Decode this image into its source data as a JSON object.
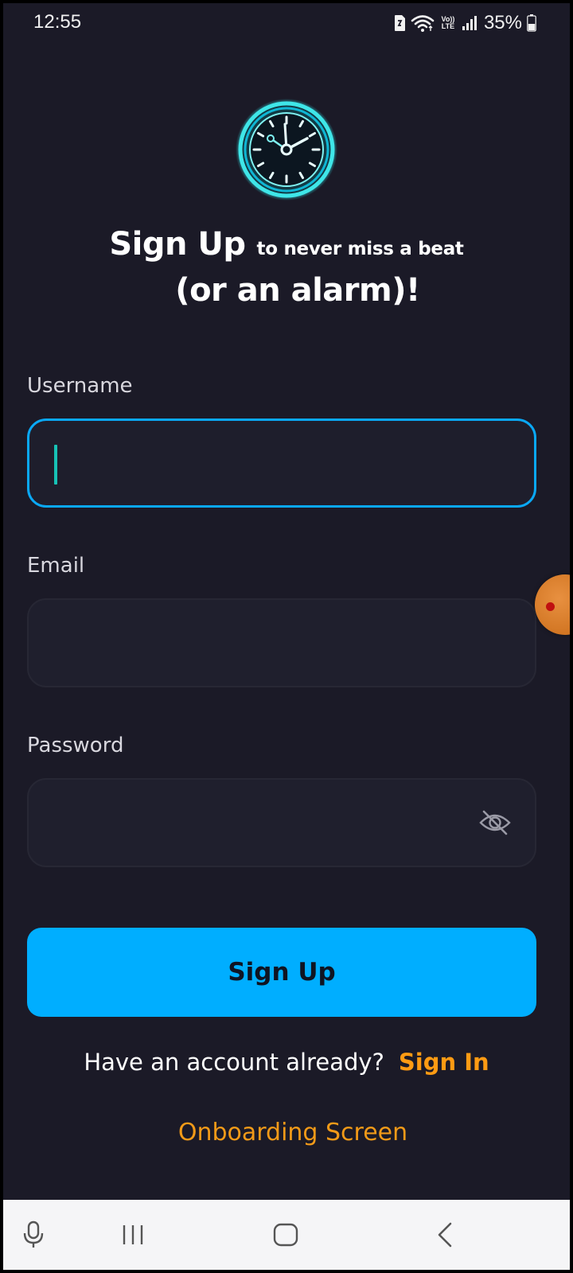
{
  "status_bar": {
    "time": "12:55",
    "volte": "Vo)) LTE",
    "battery_percent": "35%",
    "icons": [
      "sim-card-icon",
      "wifi-icon",
      "volte-icon",
      "signal-icon",
      "battery-icon"
    ]
  },
  "logo": {
    "icon": "clock-icon"
  },
  "headline": {
    "main": "Sign Up",
    "sub": "to never miss a beat",
    "line2": "(or an alarm)!"
  },
  "form": {
    "username_label": "Username",
    "username_value": "",
    "email_label": "Email",
    "email_value": "",
    "password_label": "Password",
    "password_value": "",
    "password_visibility_icon": "eye-off-icon"
  },
  "signup_button": "Sign Up",
  "account_prompt": "Have an account already?",
  "signin_link": "Sign In",
  "onboarding_link": "Onboarding Screen",
  "nav_bar": {
    "icons": [
      "microphone-icon",
      "recent-apps-icon",
      "home-icon",
      "back-icon"
    ]
  },
  "colors": {
    "background": "#1b1a27",
    "accent": "#00aeff",
    "link": "#ff9b13",
    "caret": "#17c2b6"
  }
}
